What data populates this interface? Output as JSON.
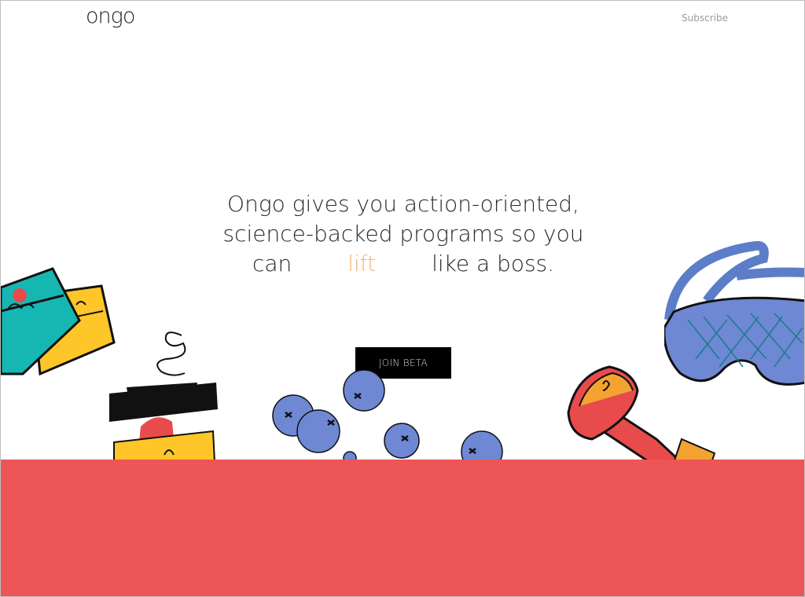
{
  "header": {
    "logo_text": "ongo",
    "subscribe_label": "Subscribe"
  },
  "hero": {
    "line1": "Ongo gives you action-oriented,",
    "line2": "science-backed programs so you",
    "line3_prefix": "can",
    "line3_highlight": "lift",
    "line3_suffix": "like a boss."
  },
  "cta": {
    "join_label": "JOIN BETA"
  },
  "colors": {
    "accent_orange": "#f4b173",
    "band_red": "#ee5556",
    "button_black": "#000000"
  },
  "illustrations": [
    "cards-icon",
    "coffee-cup-icon",
    "blueberries-icon",
    "dumbbell-icon",
    "sleep-mask-icon"
  ]
}
